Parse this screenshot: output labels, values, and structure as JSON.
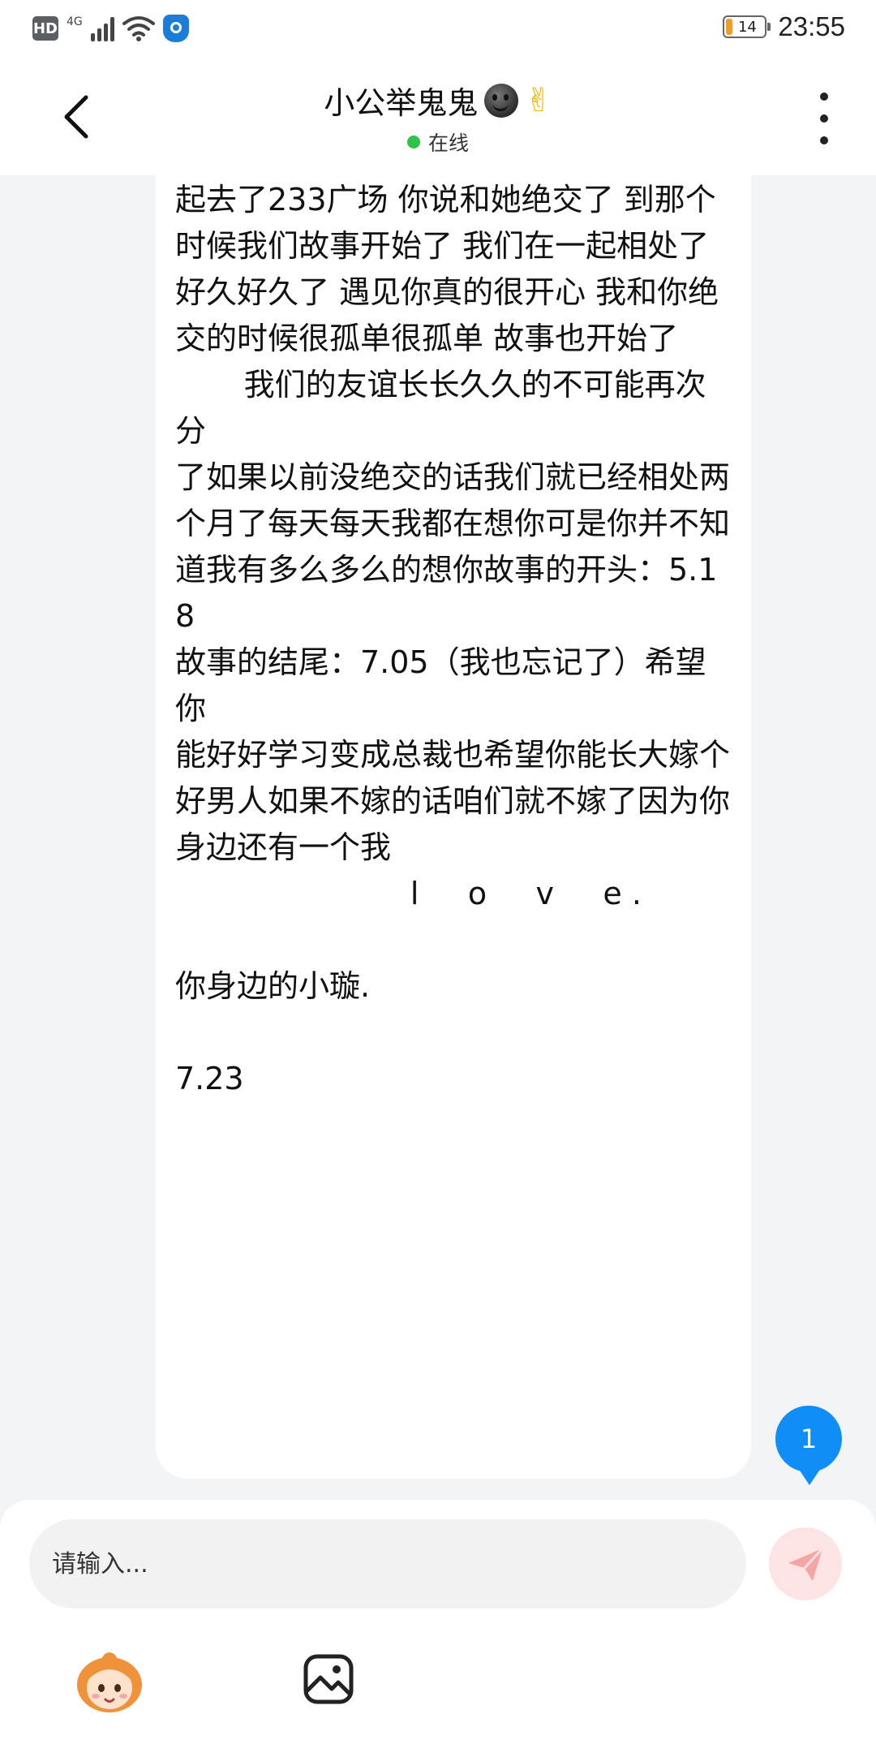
{
  "status_bar": {
    "hd_label": "HD",
    "network_label": "4G",
    "battery_level": "14",
    "time": "23:55",
    "icons": [
      "hd-icon",
      "signal-icon",
      "wifi-icon",
      "shield-icon",
      "battery-icon"
    ]
  },
  "header": {
    "title": "小公举鬼鬼",
    "status_text": "在线",
    "back_icon": "chevron-left-icon",
    "more_icon": "more-vertical-icon"
  },
  "message": {
    "text": "起去了233广场 你说和她绝交了 到那个\n时候我们故事开始了 我们在一起相处了\n好久好久了 遇见你真的很开心 我和你绝\n交的时候很孤单很孤单 故事也开始了\n       我们的友谊长长久久的不可能再次分\n了如果以前没绝交的话我们就已经相处两\n个月了每天每天我都在想你可是你并不知\n道我有多么多么的想你故事的开头：5.18\n故事的结尾：7.05（我也忘记了）希望你\n能好好学习变成总裁也希望你能长大嫁个\n好男人如果不嫁的话咱们就不嫁了因为你\n身边还有一个我\n                        l     o     v     e .\n\n你身边的小璇.\n\n7.23"
  },
  "unread_badge": {
    "count": "1"
  },
  "composer": {
    "placeholder": "请输入...",
    "send_icon": "send-icon",
    "toolbar_icons": [
      "avatar-icon",
      "image-icon"
    ]
  },
  "colors": {
    "accent": "#0f8ef7",
    "online": "#2ec44a",
    "send_bg": "#fde4e4",
    "send_icon": "#f6a5a5"
  }
}
